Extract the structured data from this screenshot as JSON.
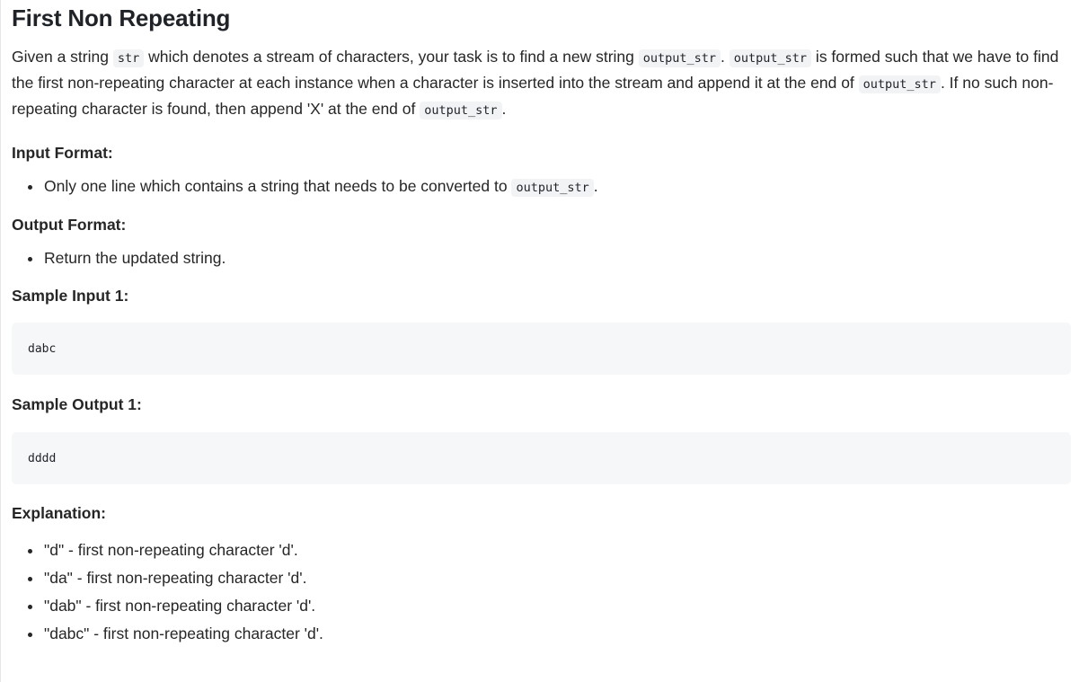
{
  "problem": {
    "title": "First Non Repeating",
    "description": {
      "t1": "Given a string ",
      "c1": "str",
      "t2": " which denotes a stream of characters, your task is to find a new string ",
      "c2": "output_str",
      "t3": ". ",
      "c3": "output_str",
      "t4": " is formed such that we have to find the first non-repeating character at each instance when a character is inserted into the stream and append it at the end of ",
      "c4": "output_str",
      "t5": ". If no such non-repeating character is found, then append 'X' at the end of ",
      "c5": "output_str",
      "t6": "."
    },
    "input_format": {
      "heading": "Input Format:",
      "item_text": "Only one line which contains a string that needs to be converted to ",
      "item_code": "output_str",
      "item_end": "."
    },
    "output_format": {
      "heading": "Output Format:",
      "item": "Return the updated string."
    },
    "sample_input": {
      "heading": "Sample Input 1:",
      "value": "dabc"
    },
    "sample_output": {
      "heading": "Sample Output 1:",
      "value": "dddd"
    },
    "explanation": {
      "heading": "Explanation:",
      "items": [
        "\"d\" - first non-repeating character 'd'.",
        "\"da\" - first non-repeating character 'd'.",
        "\"dab\" - first non-repeating character 'd'.",
        "\"dabc\" - first non-repeating character 'd'."
      ]
    }
  }
}
